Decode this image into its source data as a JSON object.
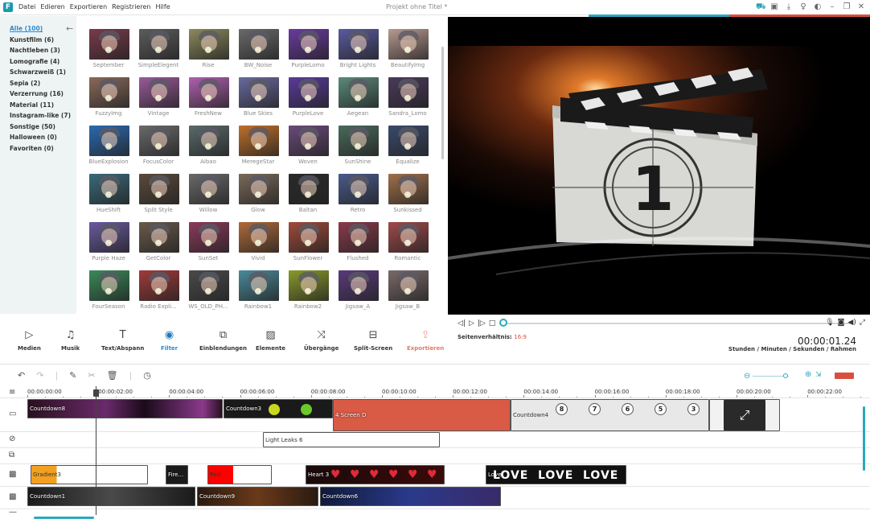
{
  "app": {
    "logo": "F",
    "title": "Projekt ohne Titel *"
  },
  "menu": [
    "Datei",
    "Edieren",
    "Exportieren",
    "Registrieren",
    "Hilfe"
  ],
  "window_icons": [
    "cart-icon",
    "save-icon",
    "download-icon",
    "lightbulb-icon",
    "brightness-icon",
    "minimize-icon",
    "restore-icon",
    "close-icon"
  ],
  "categories": [
    {
      "label": "Alle (100)",
      "active": true
    },
    {
      "label": "Kunstfilm (6)"
    },
    {
      "label": "Nachtleben (3)"
    },
    {
      "label": "Lomografie (4)"
    },
    {
      "label": "Schwarzweiß (1)"
    },
    {
      "label": "Sepia (2)"
    },
    {
      "label": "Verzerrung (16)"
    },
    {
      "label": "Material (11)"
    },
    {
      "label": "Instagram-like (7)"
    },
    {
      "label": "Sonstige (50)"
    },
    {
      "label": "Halloween (0)"
    },
    {
      "label": "Favoriten (0)"
    }
  ],
  "filters": [
    {
      "name": "September",
      "color": "#7a3a4a"
    },
    {
      "name": "SimpleElegent",
      "color": "#5c5c5c"
    },
    {
      "name": "Rise",
      "color": "#8c8a5c"
    },
    {
      "name": "BW_Noise",
      "color": "#6a6a6a"
    },
    {
      "name": "PurpleLomo",
      "color": "#6a3aa0"
    },
    {
      "name": "Bright Lights",
      "color": "#5a5aa0"
    },
    {
      "name": "BeautifyImg",
      "color": "#b89a90"
    },
    {
      "name": "FuzzyImg",
      "color": "#8a6a5a"
    },
    {
      "name": "Vintage",
      "color": "#9a5a9a"
    },
    {
      "name": "FreshNew",
      "color": "#b060b0"
    },
    {
      "name": "Blue Skies",
      "color": "#6a6aa0"
    },
    {
      "name": "PurpleLove",
      "color": "#5a3a9a"
    },
    {
      "name": "Aegean",
      "color": "#5a8a7a"
    },
    {
      "name": "Sandra_Lomo",
      "color": "#4a3a5a"
    },
    {
      "name": "BlueExplosion",
      "color": "#2a6ab0"
    },
    {
      "name": "FocusColor",
      "color": "#6a6a6a"
    },
    {
      "name": "Aibao",
      "color": "#5a6a6a"
    },
    {
      "name": "MeregeStar",
      "color": "#c0702a"
    },
    {
      "name": "Woven",
      "color": "#6a4a7a"
    },
    {
      "name": "SunShine",
      "color": "#4a6a5a"
    },
    {
      "name": "Equalize",
      "color": "#3a4a6a"
    },
    {
      "name": "HueShift",
      "color": "#3a6a7a"
    },
    {
      "name": "Split Style",
      "color": "#5a4a3a"
    },
    {
      "name": "Willow",
      "color": "#6a6a6a"
    },
    {
      "name": "Glow",
      "color": "#7a6a5a"
    },
    {
      "name": "Baltan",
      "color": "#2a2a2a"
    },
    {
      "name": "Retro",
      "color": "#4a5a8a"
    },
    {
      "name": "Sunkissed",
      "color": "#a0704a"
    },
    {
      "name": "Purple Haze",
      "color": "#6a5aa0"
    },
    {
      "name": "GetColor",
      "color": "#6a5a4a"
    },
    {
      "name": "SunSet",
      "color": "#8a3a5a"
    },
    {
      "name": "Vivid",
      "color": "#b06a3a"
    },
    {
      "name": "SunFlower",
      "color": "#a04a3a"
    },
    {
      "name": "Flushed",
      "color": "#8a3a4a"
    },
    {
      "name": "Romantic",
      "color": "#a04a4a"
    },
    {
      "name": "FourSeason",
      "color": "#3a8a5a"
    },
    {
      "name": "Radio Expli...",
      "color": "#a03a3a"
    },
    {
      "name": "WS_OLD_PH...",
      "color": "#4a4a4a"
    },
    {
      "name": "Rainbow1",
      "color": "#4a8a9a"
    },
    {
      "name": "Rainbow2",
      "color": "#8a9a2a"
    },
    {
      "name": "Jigsaw_A",
      "color": "#5a3a7a"
    },
    {
      "name": "Jigsaw_B",
      "color": "#7a6a6a"
    }
  ],
  "tools": [
    {
      "label": "Medien",
      "icon": "media-icon"
    },
    {
      "label": "Musik",
      "icon": "music-icon"
    },
    {
      "label": "Text/Abspann",
      "icon": "text-icon"
    },
    {
      "label": "Filter",
      "icon": "filter-icon",
      "active": true
    },
    {
      "label": "Einblendungen",
      "icon": "overlay-icon"
    },
    {
      "label": "Elemente",
      "icon": "elements-icon"
    },
    {
      "label": "Übergänge",
      "icon": "transitions-icon"
    },
    {
      "label": "Split-Screen",
      "icon": "split-screen-icon"
    },
    {
      "label": "Exportieren",
      "icon": "export-icon",
      "disabled": true
    }
  ],
  "preview": {
    "aspect_label": "Seitenverhältnis:",
    "aspect_value": "16:9",
    "timecode": "00:00:01.24",
    "timecode_label": "Stunden / Minuten / Sekunden / Rahmen",
    "countdown_digit": "1"
  },
  "ruler": [
    "00:00:00:00",
    "00:00:02:00",
    "00:00:04:00",
    "00:00:06:00",
    "00:00:08:00",
    "00:00:10:00",
    "00:00:12:00",
    "00:00:14:00",
    "00:00:16:00",
    "00:00:18:00",
    "00:00:20:00",
    "00:00:22:00"
  ],
  "tracks": {
    "video": [
      {
        "label": "Countdown8",
        "color": "#3a1a3a"
      },
      {
        "label": "Countdown3",
        "color": "#1a1a1a"
      },
      {
        "label": "4 Screen D",
        "color": "#d95a45"
      },
      {
        "label": "Countdown4",
        "color": "#e8e8e8"
      },
      {
        "label": "",
        "color": "#f2f2f2"
      }
    ],
    "effect": [
      {
        "label": "Light Leaks 6",
        "color": "#ffffff"
      }
    ],
    "pip": [
      {
        "label": "Gradient3",
        "color": "#e08a20"
      },
      {
        "label": "Fire...",
        "color": "#1a1a1a"
      },
      {
        "label": "Red",
        "color": "#ff0000"
      },
      {
        "label": "Heart 3",
        "color": "#1a0a0a"
      },
      {
        "label": "Love",
        "color": "#111111"
      }
    ],
    "pip_text": {
      "love": "LOVE"
    },
    "base": [
      {
        "label": "Countdown1",
        "color": "#1a1a1a"
      },
      {
        "label": "Countdown9",
        "color": "#3a2010"
      },
      {
        "label": "Countdown6",
        "color": "#1a2a5a"
      }
    ],
    "countdown_numbers": [
      "8",
      "7",
      "6",
      "5",
      "3"
    ]
  },
  "colors": {
    "accent": "#2aa9bd",
    "link": "#2a8bd0",
    "export": "#d94f3f"
  }
}
